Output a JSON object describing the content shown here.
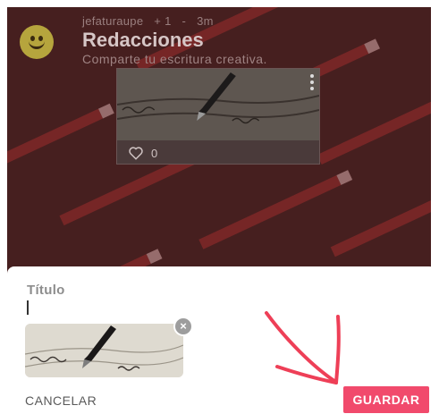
{
  "community": {
    "user": "jefaturaupe",
    "members": "+ 1",
    "separator": "-",
    "time": "3m",
    "title": "Redacciones",
    "subtitle": "Comparte tu escritura creativa."
  },
  "post": {
    "likes": "0"
  },
  "editor": {
    "title_label": "Título",
    "title_value": "",
    "remove_symbol": "×",
    "cancel_label": "CANCELAR",
    "save_label": "GUARDAR"
  },
  "colors": {
    "accent": "#f14a6c",
    "annotation_arrow": "#ee3f57",
    "overlay_bg": "#4a2323"
  },
  "icons": {
    "avatar": "smiley-face-icon",
    "like": "heart-outline-icon",
    "menu": "more-vertical-icon",
    "remove": "close-icon"
  }
}
